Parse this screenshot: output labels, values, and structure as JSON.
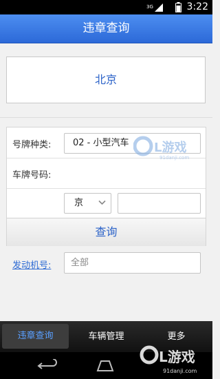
{
  "status_bar": {
    "network": "3G",
    "time": "3:22"
  },
  "header": {
    "title": "违章查询"
  },
  "city": {
    "name": "北京"
  },
  "form": {
    "plate_type_label": "号牌种类:",
    "plate_type_value": "02 - 小型汽车",
    "plate_number_label": "车牌号码:",
    "province_value": "京",
    "plate_number_value": "",
    "engine_label": "发动机号:",
    "engine_placeholder": "全部",
    "query_button": "查询"
  },
  "bottom_tabs": [
    {
      "label": "违章查询",
      "active": true
    },
    {
      "label": "车辆管理",
      "active": false
    },
    {
      "label": "更多",
      "active": false
    }
  ],
  "watermark": {
    "text": "91游戏",
    "sub": "91danji.com"
  },
  "colors": {
    "header": "#2c69d8",
    "accent": "#2b62c8",
    "link": "#2d6ad3"
  }
}
